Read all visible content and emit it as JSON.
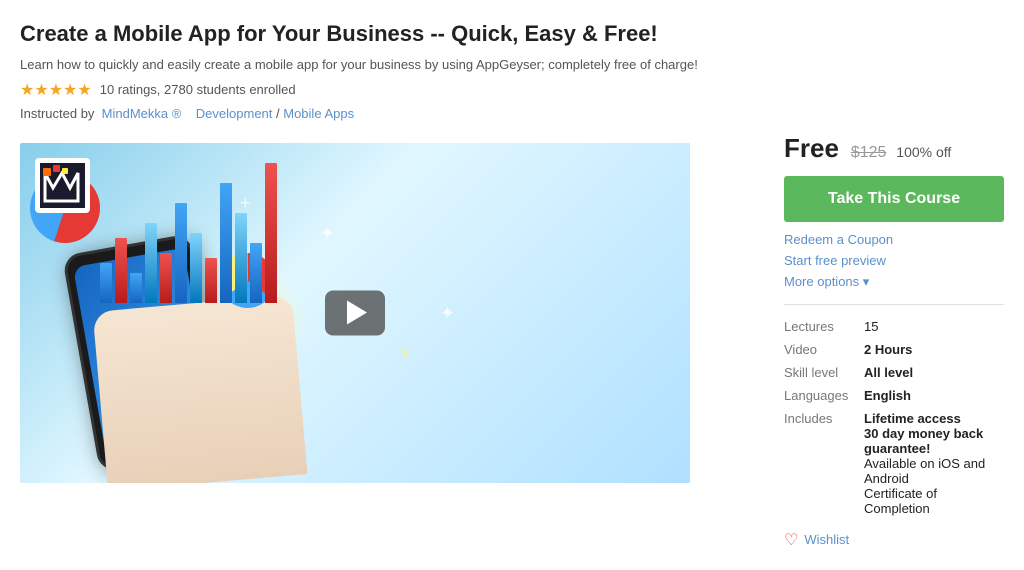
{
  "course": {
    "title": "Create a Mobile App for Your Business -- Quick, Easy & Free!",
    "description": "Learn how to quickly and easily create a mobile app for your business by using AppGeyser; completely free of charge!",
    "ratings_count": "10 ratings, 2780 students enrolled",
    "instructor_label": "Instructed by",
    "instructor_name": "MindMekka ®",
    "instructor_url": "#",
    "breadcrumb_sep": " / ",
    "breadcrumb_cat": "Development",
    "breadcrumb_sub": "Mobile Apps",
    "stars": "★★★★★"
  },
  "pricing": {
    "free_label": "Free",
    "original_price": "$125",
    "discount_label": "100% off",
    "take_course_label": "Take This Course",
    "coupon_label": "Redeem a Coupon",
    "preview_label": "Start free preview",
    "more_options_label": "More options ▾"
  },
  "meta": {
    "lectures_label": "Lectures",
    "lectures_value": "15",
    "video_label": "Video",
    "video_value": "2 Hours",
    "skill_label": "Skill level",
    "skill_value": "All level",
    "languages_label": "Languages",
    "languages_value": "English",
    "includes_label": "Includes",
    "includes_line1": "Lifetime access",
    "includes_line2": "30 day money back guarantee!",
    "includes_line3": "Available on iOS and Android",
    "includes_line4": "Certificate of Completion"
  },
  "wishlist": {
    "label": "Wishlist"
  },
  "logo": {
    "alt": "MindMekka logo"
  }
}
